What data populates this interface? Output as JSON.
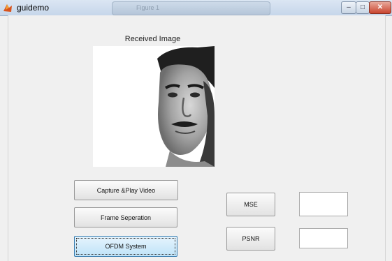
{
  "window": {
    "title": "guidemo",
    "background_tab_label": "Figure 1"
  },
  "image_panel": {
    "caption": "Received Image"
  },
  "buttons": {
    "capture": "Capture &Play Video",
    "frame": "Frame Seperation",
    "ofdm": "OFDM System",
    "mse": "MSE",
    "psnr": "PSNR"
  },
  "fields": {
    "mse_value": "",
    "psnr_value": ""
  },
  "colors": {
    "window_bg": "#f0f0f0",
    "selected_button": "#bfe3f8",
    "close_button": "#c9452f"
  }
}
